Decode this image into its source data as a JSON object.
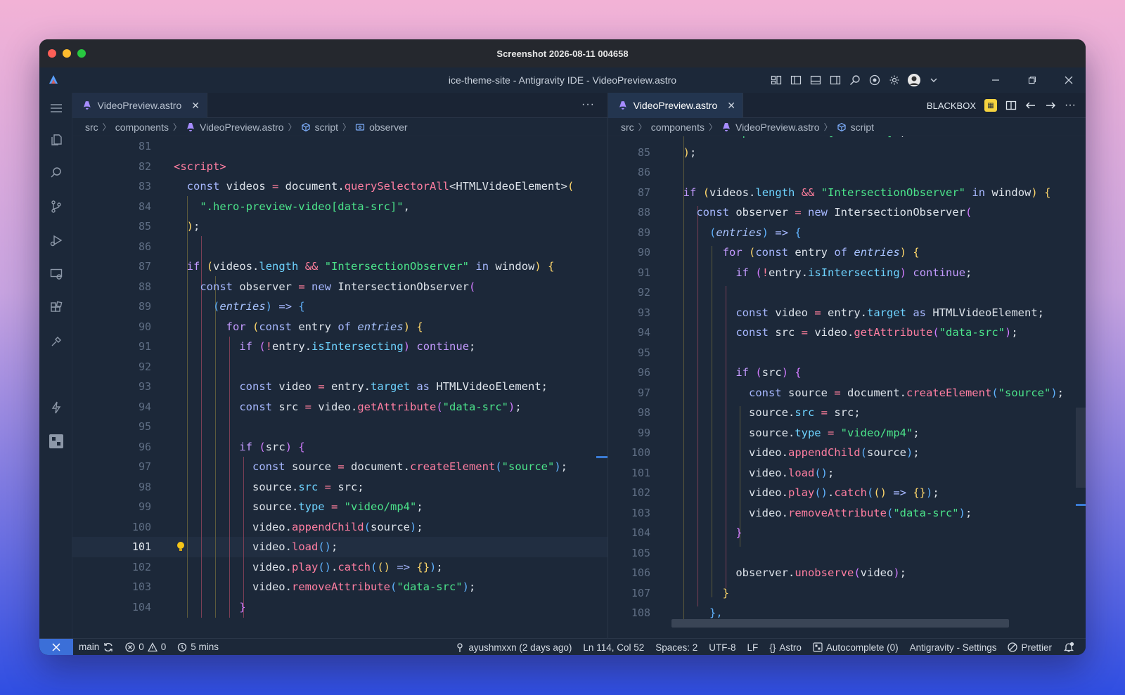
{
  "mac": {
    "title": "Screenshot 2026-08-11 004658"
  },
  "app": {
    "title": "ice-theme-site - Antigravity IDE - VideoPreview.astro"
  },
  "left_pane": {
    "tab": {
      "label": "VideoPreview.astro"
    },
    "breadcrumb": [
      "src",
      "components",
      "VideoPreview.astro",
      "script",
      "observer"
    ]
  },
  "right_pane": {
    "tab": {
      "label": "VideoPreview.astro"
    },
    "blackbox_label": "BLACKBOX",
    "breadcrumb": [
      "src",
      "components",
      "VideoPreview.astro",
      "script"
    ]
  },
  "editor": {
    "current_line": "101"
  },
  "status": {
    "branch": "main",
    "errors": "0",
    "warnings": "0",
    "timer": "5 mins",
    "blame": "ayushmxxn (2 days ago)",
    "position": "Ln 114, Col 52",
    "spaces": "Spaces: 2",
    "encoding": "UTF-8",
    "eol": "LF",
    "language": "Astro",
    "autocomplete": "Autocomplete (0)",
    "settings": "Antigravity - Settings",
    "formatter": "Prettier"
  },
  "colors": {
    "accent": "#3b6fd8",
    "background": "#1c2839",
    "string": "#4be38a",
    "function": "#ff7ea1"
  }
}
